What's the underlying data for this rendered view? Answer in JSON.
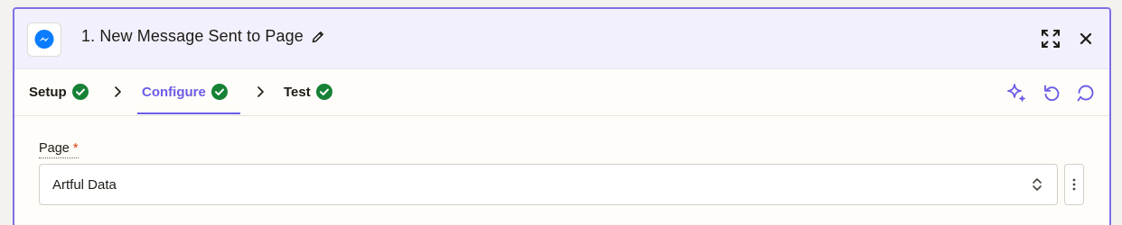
{
  "step": {
    "app_icon": "messenger-icon",
    "title": "1. New Message Sent to Page",
    "edit_icon": "pencil-icon",
    "actions": [
      "expand-icon",
      "close-icon"
    ]
  },
  "tabs": [
    {
      "label": "Setup",
      "status_icon": "check-circle-icon",
      "active": false
    },
    {
      "label": "Configure",
      "status_icon": "check-circle-icon",
      "active": true
    },
    {
      "label": "Test",
      "status_icon": "check-circle-icon",
      "active": false
    }
  ],
  "toolbar_icons": [
    "sparkle-icon",
    "undo-icon",
    "comment-icon"
  ],
  "form": {
    "page_field": {
      "label": "Page",
      "required_mark": "*",
      "value": "Artful Data"
    }
  },
  "colors": {
    "accent": "#6b5ce7",
    "success": "#178136",
    "required": "#d9420b",
    "messenger": "#0a7cff"
  }
}
